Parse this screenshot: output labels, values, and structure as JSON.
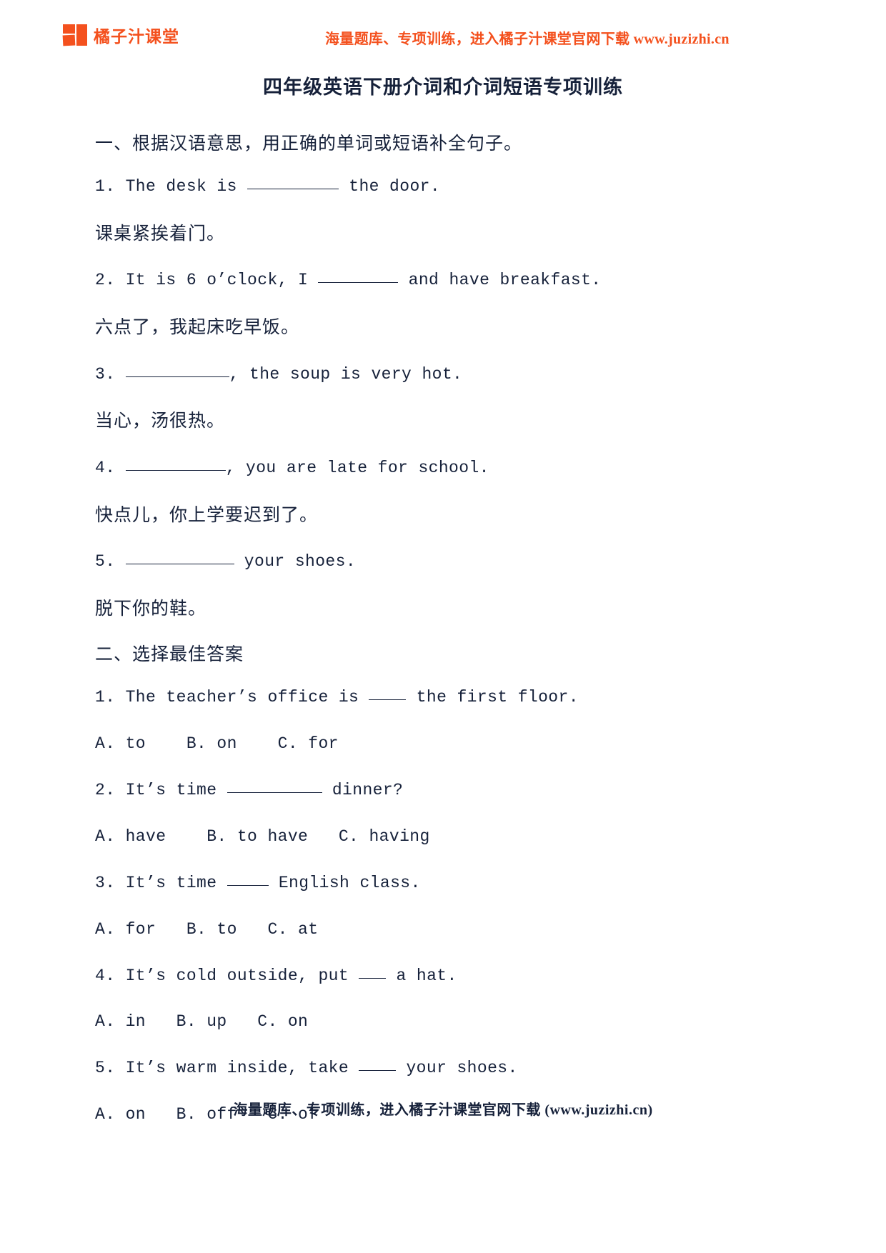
{
  "header": {
    "brand_name": "橘子汁课堂",
    "logo_icon": "squares-logo-icon",
    "promo_text": "海量题库、专项训练，进入橘子汁课堂官网下载 www.juzizhi.cn",
    "brand_color": "#f4511e"
  },
  "title": "四年级英语下册介词和介词短语专项训练",
  "sections": [
    {
      "heading": "一、根据汉语意思，用正确的单词或短语补全句子。",
      "items": [
        {
          "en_before": "1. The desk is ",
          "en_after": " the door.",
          "zh": "课桌紧挨着门。"
        },
        {
          "en_before": "2. It is 6 o’clock, I ",
          "en_after": " and have breakfast.",
          "zh": "六点了，我起床吃早饭。"
        },
        {
          "en_before": "3. ",
          "en_after": ", the soup is very hot.",
          "zh": "当心，汤很热。"
        },
        {
          "en_before": "4. ",
          "en_after": ", you are late for school.",
          "zh": "快点儿，你上学要迟到了。"
        },
        {
          "en_before": "5. ",
          "en_after": " your shoes.",
          "zh": "脱下你的鞋。"
        }
      ]
    },
    {
      "heading": "二、选择最佳答案",
      "items": [
        {
          "en_before": "1. The teacher’s office is ",
          "en_after": " the first floor.",
          "options": "A. to    B. on    C. for"
        },
        {
          "en_before": "2. It’s time ",
          "en_after": " dinner?",
          "options": "A. have    B. to have   C. having"
        },
        {
          "en_before": "3. It’s time ",
          "en_after": " English class.",
          "options": "A. for   B. to   C. at"
        },
        {
          "en_before": "4. It’s cold outside, put ",
          "en_after": " a hat.",
          "options": "A. in   B. up   C. on"
        },
        {
          "en_before": "5. It’s warm inside, take ",
          "en_after": " your shoes.",
          "options": "A. on   B. off   C. of"
        }
      ]
    }
  ],
  "footer": {
    "text": "海量题库、专项训练，进入橘子汁课堂官网下载 (www.juzizhi.cn)"
  }
}
